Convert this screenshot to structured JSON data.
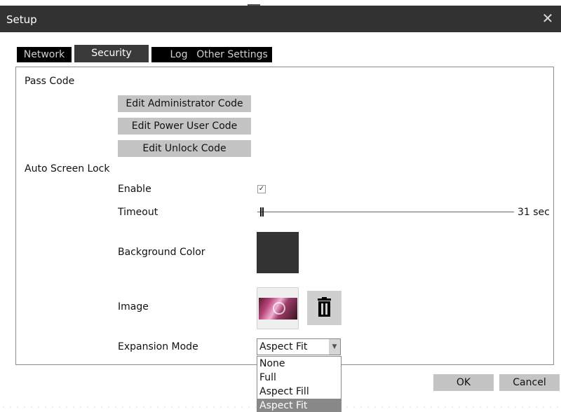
{
  "window": {
    "title": "Setup",
    "close_glyph": "✕"
  },
  "tabs": [
    {
      "label": "Network",
      "active": false
    },
    {
      "label": "Security",
      "active": true
    },
    {
      "label": "Log",
      "active": false
    },
    {
      "label": "Other Settings",
      "active": false
    }
  ],
  "passcode": {
    "heading": "Pass Code",
    "buttons": [
      "Edit Administrator Code",
      "Edit Power User Code",
      "Edit Unlock Code"
    ]
  },
  "autolock": {
    "heading": "Auto Screen Lock",
    "enable_label": "Enable",
    "enable_checked": true,
    "check_glyph": "✓",
    "timeout_label": "Timeout",
    "timeout_value": "31 sec",
    "background_label": "Background Color",
    "background_color": "#333333",
    "image_label": "Image",
    "trash_icon": "trash-icon",
    "expansion_label": "Expansion Mode",
    "expansion_value": "Aspect Fit",
    "expansion_arrow": "▼",
    "expansion_options": [
      "None",
      "Full",
      "Aspect Fill",
      "Aspect Fit"
    ],
    "expansion_selected_index": 3
  },
  "footer": {
    "ok": "OK",
    "cancel": "Cancel"
  }
}
